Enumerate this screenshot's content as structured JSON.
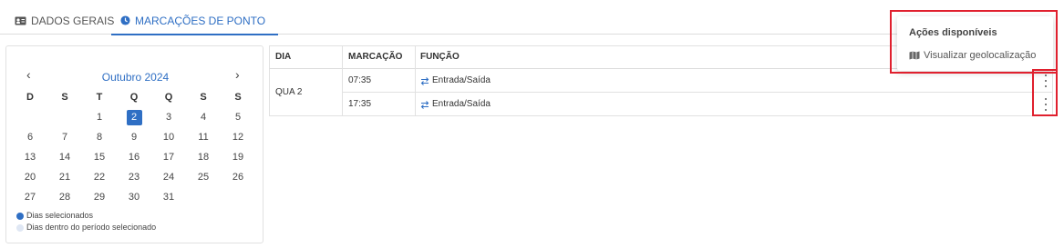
{
  "tabs": [
    {
      "label": "DADOS GERAIS",
      "icon": "id-card-icon",
      "active": false
    },
    {
      "label": "MARCAÇÕES DE PONTO",
      "icon": "clock-icon",
      "active": true
    }
  ],
  "calendar": {
    "month_label": "Outubro 2024",
    "prev": "‹",
    "next": "›",
    "weekdays": [
      "D",
      "S",
      "T",
      "Q",
      "Q",
      "S",
      "S"
    ],
    "weeks": [
      [
        "",
        "",
        "1",
        "2",
        "3",
        "4",
        "5"
      ],
      [
        "6",
        "7",
        "8",
        "9",
        "10",
        "11",
        "12"
      ],
      [
        "13",
        "14",
        "15",
        "16",
        "17",
        "18",
        "19"
      ],
      [
        "20",
        "21",
        "22",
        "23",
        "24",
        "25",
        "26"
      ],
      [
        "27",
        "28",
        "29",
        "30",
        "31",
        "",
        ""
      ]
    ],
    "selected_day": "2",
    "legend": [
      {
        "label": "Dias selecionados",
        "color": "#2f6fc4"
      },
      {
        "label": "Dias dentro do período selecionado",
        "color": "#dfe7f4"
      }
    ]
  },
  "table": {
    "headers": {
      "dia": "DIA",
      "marcacao": "MARCAÇÃO",
      "funcao": "FUNÇÃO"
    },
    "day_label": "QUA 2",
    "rows": [
      {
        "marcacao": "07:35",
        "funcao": "Entrada/Saída",
        "icon": "swap-arrows-icon"
      },
      {
        "marcacao": "17:35",
        "funcao": "Entrada/Saída",
        "icon": "swap-arrows-icon"
      }
    ]
  },
  "actions_menu": {
    "title": "Ações disponíveis",
    "items": [
      {
        "label": "Visualizar geolocalização",
        "icon": "map-icon"
      }
    ]
  },
  "colors": {
    "accent": "#2f6fc4",
    "highlight": "#e0202e"
  }
}
